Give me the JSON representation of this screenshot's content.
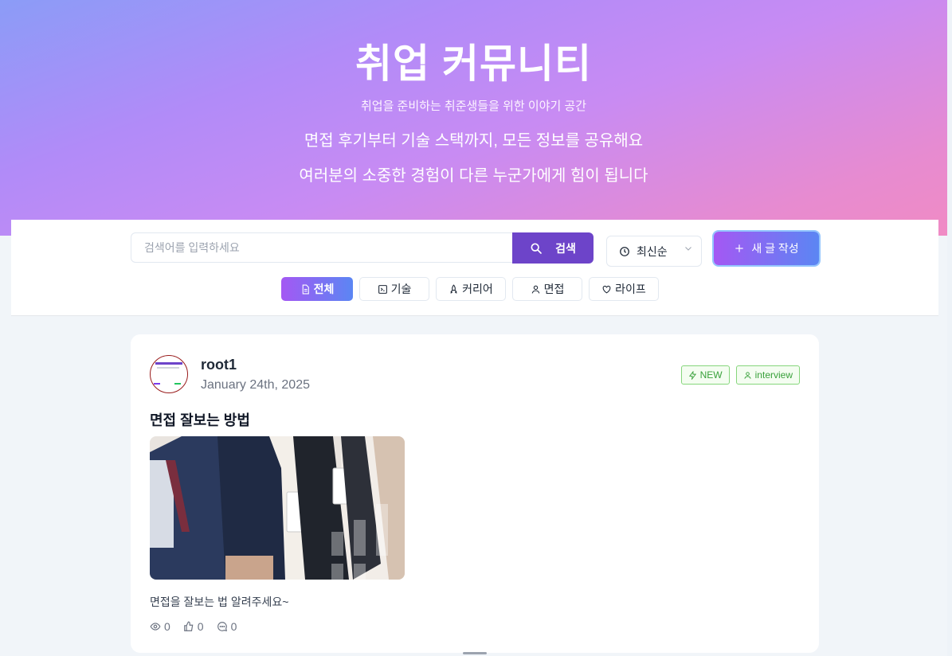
{
  "hero": {
    "title": "취업 커뮤니티",
    "subtitle": "취업을 준비하는 취준생들을 위한 이야기 공간",
    "line1": "면접 후기부터 기술 스택까지, 모든 정보를 공유해요",
    "line2": "여러분의 소중한 경험이 다른 누군가에게 힘이 됩니다"
  },
  "search": {
    "placeholder": "검색어를 입력하세요",
    "value": "",
    "button_label": "검색",
    "icon": "search-icon"
  },
  "sort": {
    "selected": "최신순",
    "icon": "clock-icon"
  },
  "new_post": {
    "label": "새 글 작성",
    "icon": "plus-icon"
  },
  "categories": [
    {
      "label": "전체",
      "icon": "file-text-icon",
      "active": true
    },
    {
      "label": "기술",
      "icon": "terminal-icon",
      "active": false
    },
    {
      "label": "커리어",
      "icon": "rocket-icon",
      "active": false
    },
    {
      "label": "면접",
      "icon": "user-icon",
      "active": false
    },
    {
      "label": "라이프",
      "icon": "heart-icon",
      "active": false
    }
  ],
  "post": {
    "author": "root1",
    "date": "January 24th, 2025",
    "tags": [
      {
        "label": "NEW",
        "icon": "zap-icon"
      },
      {
        "label": "interview",
        "icon": "user-icon"
      }
    ],
    "title": "면접 잘보는 방법",
    "excerpt": "면접을 잘보는 법 알려주세요~",
    "views": "0",
    "likes": "0",
    "comments": "0"
  },
  "colors": {
    "accent_purple": "#6d44c9",
    "gradient_start": "#a458f3",
    "gradient_end": "#5b86f3",
    "tag_green": "#38a03a"
  }
}
